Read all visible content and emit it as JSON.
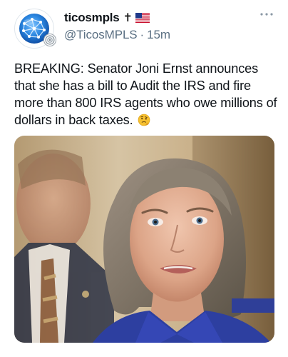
{
  "tweet": {
    "display_name": "ticosmpls",
    "name_emoji_cross": "✝",
    "handle": "@TicosMPLS",
    "separator": "·",
    "timestamp": "15m",
    "text": "BREAKING: Senator Joni Ernst announces that she has a bill to Audit the IRS and fire more than 800 IRS agents who owe millions of dollars in back taxes.",
    "text_emoji": "thinking-face",
    "media_description_icon": "photo"
  },
  "colors": {
    "primary_text": "#0f1419",
    "secondary_text": "#5b7083",
    "background": "#ffffff",
    "avatar_globe": "#1f6fd1"
  },
  "icons": {
    "more": "more-horizontal-icon",
    "avatar": "globe-network-icon",
    "flag": "us-flag-icon"
  }
}
